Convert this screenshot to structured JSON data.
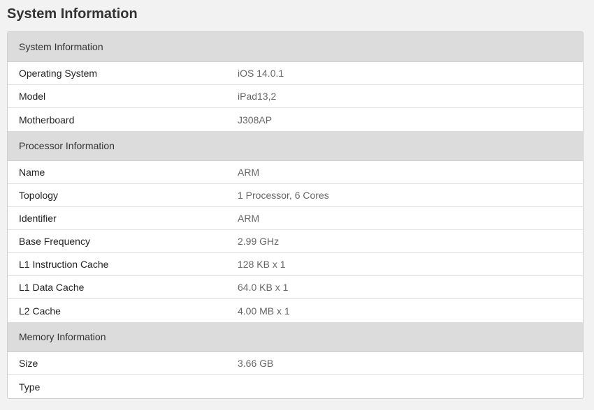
{
  "page": {
    "title": "System Information"
  },
  "sections": [
    {
      "header": "System Information",
      "rows": [
        {
          "label": "Operating System",
          "value": "iOS 14.0.1"
        },
        {
          "label": "Model",
          "value": "iPad13,2"
        },
        {
          "label": "Motherboard",
          "value": "J308AP"
        }
      ]
    },
    {
      "header": "Processor Information",
      "rows": [
        {
          "label": "Name",
          "value": "ARM"
        },
        {
          "label": "Topology",
          "value": "1 Processor, 6 Cores"
        },
        {
          "label": "Identifier",
          "value": "ARM"
        },
        {
          "label": "Base Frequency",
          "value": "2.99 GHz"
        },
        {
          "label": "L1 Instruction Cache",
          "value": "128 KB x 1"
        },
        {
          "label": "L1 Data Cache",
          "value": "64.0 KB x 1"
        },
        {
          "label": "L2 Cache",
          "value": "4.00 MB x 1"
        }
      ]
    },
    {
      "header": "Memory Information",
      "rows": [
        {
          "label": "Size",
          "value": "3.66 GB"
        },
        {
          "label": "Type",
          "value": ""
        }
      ]
    }
  ],
  "colors": {
    "page_background": "#f2f2f2",
    "section_header_background": "#dcdcdc",
    "table_background": "#ffffff",
    "label_text": "#222222",
    "value_text": "#666666"
  }
}
